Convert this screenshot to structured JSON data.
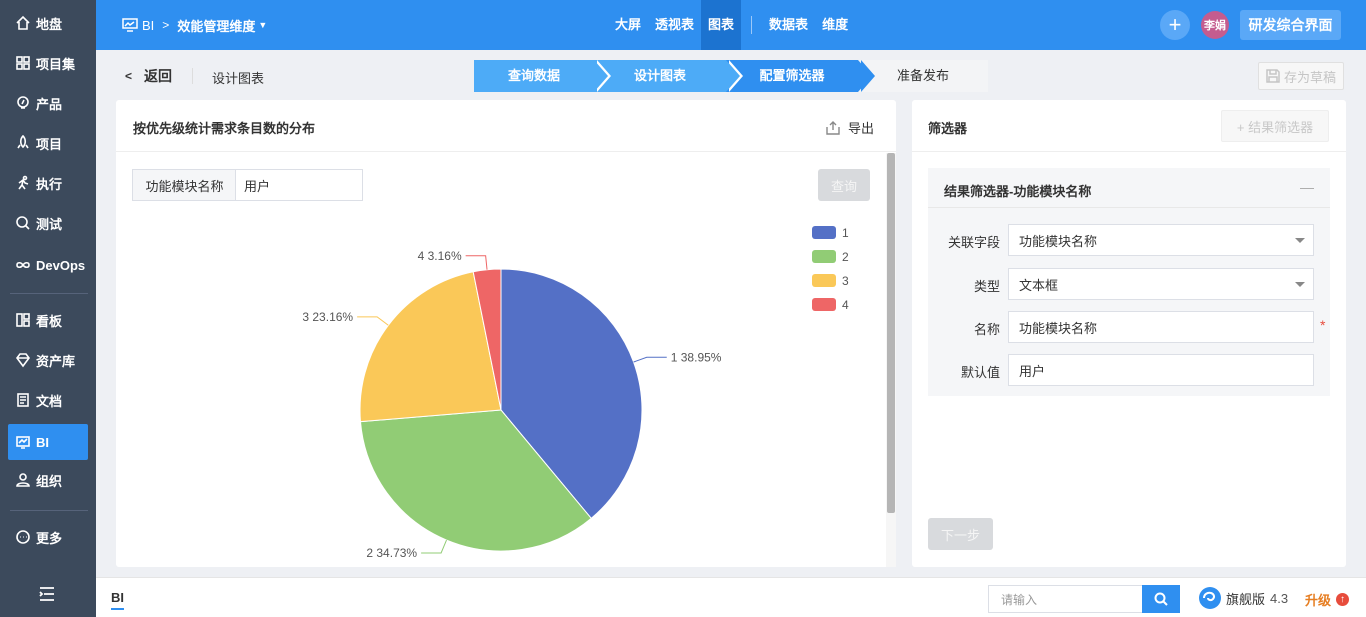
{
  "sidebar": {
    "items": [
      {
        "label": "地盘",
        "icon": "home-icon"
      },
      {
        "label": "项目集",
        "icon": "grid-icon"
      },
      {
        "label": "产品",
        "icon": "lightbulb-icon"
      },
      {
        "label": "项目",
        "icon": "rocket-icon"
      },
      {
        "label": "执行",
        "icon": "run-icon"
      },
      {
        "label": "测试",
        "icon": "magnifier-icon"
      },
      {
        "label": "DevOps",
        "icon": "infinity-icon"
      },
      {
        "label": "看板",
        "icon": "kanban-icon"
      },
      {
        "label": "资产库",
        "icon": "diamond-icon"
      },
      {
        "label": "文档",
        "icon": "document-icon"
      },
      {
        "label": "BI",
        "icon": "monitor-icon",
        "active": true
      },
      {
        "label": "组织",
        "icon": "user-icon"
      },
      {
        "label": "更多",
        "icon": "more-icon"
      }
    ]
  },
  "topbar": {
    "module": "BI",
    "project": "效能管理维度",
    "nav": [
      "大屏",
      "透视表",
      "图表",
      "数据表",
      "维度"
    ],
    "active_nav": "图表",
    "user": "李娟",
    "workspace": "研发综合界面"
  },
  "subheader": {
    "back": "返回",
    "title": "设计图表",
    "steps": [
      "查询数据",
      "设计图表",
      "配置筛选器",
      "准备发布"
    ],
    "save_draft": "存为草稿"
  },
  "chart_card": {
    "title": "按优先级统计需求条目数的分布",
    "export": "导出",
    "filter_label": "功能模块名称",
    "filter_value": "用户",
    "query": "查询"
  },
  "chart_data": {
    "type": "pie",
    "categories": [
      "1",
      "2",
      "3",
      "4"
    ],
    "values": [
      38.95,
      34.73,
      23.16,
      3.16
    ],
    "labels": [
      "1 38.95%",
      "2 34.73%",
      "3 23.16%",
      "4 3.16%"
    ],
    "colors": [
      "#5470c6",
      "#91cc75",
      "#fac858",
      "#ee6666"
    ],
    "legend_position": "top-right"
  },
  "filter_card": {
    "title": "筛选器",
    "add": "+ 结果筛选器",
    "panel_title": "结果筛选器-功能模块名称",
    "collapse": "—",
    "fields": [
      {
        "label": "关联字段",
        "value": "功能模块名称",
        "dropdown": true
      },
      {
        "label": "类型",
        "value": "文本框",
        "dropdown": true
      },
      {
        "label": "名称",
        "value": "功能模块名称",
        "required": true
      },
      {
        "label": "默认值",
        "value": "用户"
      }
    ],
    "next": "下一步"
  },
  "bottombar": {
    "tab": "BI",
    "search_placeholder": "请输入",
    "edition": "旗舰版",
    "version": "4.3",
    "upgrade": "升级"
  }
}
